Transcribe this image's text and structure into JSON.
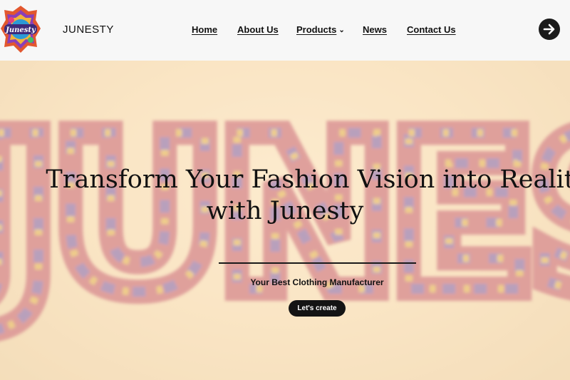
{
  "header": {
    "brand": "JUNESTY",
    "logo_text": "Junesty",
    "nav": {
      "home": "Home",
      "about": "About Us",
      "products": "Products",
      "news": "News",
      "contact": "Contact Us"
    },
    "products_chevron": "chevron-down-icon",
    "action_icon": "arrow-right-icon"
  },
  "hero": {
    "title_line1": "Transform Your Fashion Vision into Reality",
    "title_line2": "with Junesty",
    "subtitle": "Your Best Clothing Manufacturer",
    "cta": "Let's create",
    "background_text": "JUNESTY"
  },
  "colors": {
    "header_bg": "#f7f7f7",
    "hero_bg": "#f5dbb5",
    "button_bg": "#141414",
    "text": "#111111"
  }
}
